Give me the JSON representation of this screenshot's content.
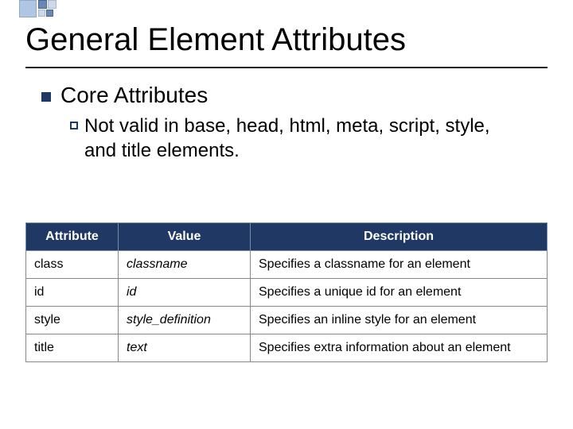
{
  "title": "General Element Attributes",
  "section": {
    "heading": "Core Attributes",
    "note": "Not valid in base, head, html, meta, script, style, and title elements."
  },
  "table": {
    "headers": {
      "attribute": "Attribute",
      "value": "Value",
      "description": "Description"
    },
    "rows": [
      {
        "attribute": "class",
        "value": "classname",
        "description": "Specifies a classname for an element"
      },
      {
        "attribute": "id",
        "value": "id",
        "description": "Specifies a unique id for an element"
      },
      {
        "attribute": "style",
        "value": "style_definition",
        "description": "Specifies an inline style for an element"
      },
      {
        "attribute": "title",
        "value": "text",
        "description": "Specifies extra information about an element"
      }
    ]
  }
}
